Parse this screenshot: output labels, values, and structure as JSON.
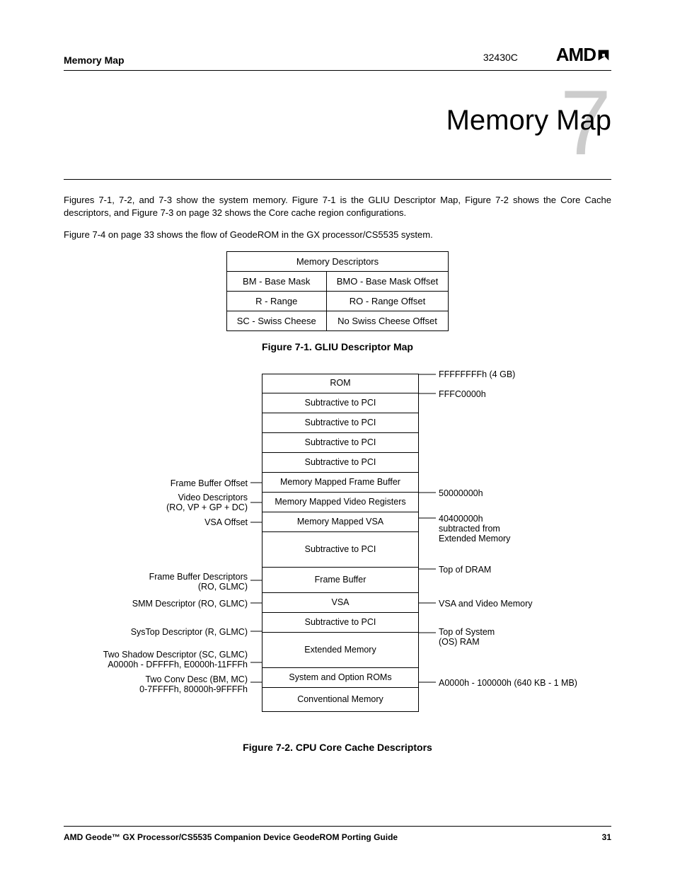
{
  "header": {
    "left": "Memory Map",
    "docnum": "32430C",
    "brand": "AMD"
  },
  "chapter": {
    "number": "7",
    "title": "Memory Map"
  },
  "paragraphs": {
    "p1": "Figures 7-1, 7-2, and 7-3 show the system memory. Figure 7-1 is the GLIU Descriptor Map, Figure 7-2 shows the Core Cache descriptors, and Figure 7-3 on page 32 shows the Core cache region configurations.",
    "p2": "Figure 7-4 on page 33 shows the flow of GeodeROM in the GX processor/CS5535 system."
  },
  "md_table": {
    "title": "Memory Descriptors",
    "rows": [
      [
        "BM - Base Mask",
        "BMO - Base Mask Offset"
      ],
      [
        "R - Range",
        "RO - Range Offset"
      ],
      [
        "SC - Swiss Cheese",
        "No Swiss Cheese Offset"
      ]
    ]
  },
  "fig1_caption": "Figure 7-1.  GLIU Descriptor Map",
  "fig2_caption": "Figure 7-2.  CPU Core Cache Descriptors",
  "diagram": {
    "boxes": [
      "ROM",
      "Subtractive to PCI",
      "Subtractive to PCI",
      "Subtractive to PCI",
      "Subtractive to PCI",
      "Memory Mapped Frame Buffer",
      "Memory Mapped Video Registers",
      "Memory Mapped VSA",
      "Subtractive to PCI",
      "Frame Buffer",
      "VSA",
      "Subtractive to PCI",
      "Extended Memory",
      "System and Option ROMs",
      "Conventional Memory"
    ],
    "left_labels": {
      "l1": "Frame Buffer Offset",
      "l2a": "Video Descriptors",
      "l2b": "(RO, VP + GP + DC)",
      "l3": "VSA Offset",
      "l4a": "Frame Buffer Descriptors",
      "l4b": "(RO, GLMC)",
      "l5": "SMM Descriptor (RO, GLMC)",
      "l6": "SysTop Descriptor (R, GLMC)",
      "l7a": "Two Shadow Descriptor (SC, GLMC)",
      "l7b": "A0000h - DFFFFh, E0000h-11FFFh",
      "l8a": "Two Conv Desc (BM, MC)",
      "l8b": "0-7FFFFh, 80000h-9FFFFh"
    },
    "right_labels": {
      "r1": "FFFFFFFFh (4 GB)",
      "r2": "FFFC0000h",
      "r3": "50000000h",
      "r4a": "40400000h",
      "r4b": "subtracted from",
      "r4c": "Extended Memory",
      "r5": "Top of DRAM",
      "r6": "VSA and Video Memory",
      "r7a": "Top of System",
      "r7b": "(OS) RAM",
      "r8": "A0000h - 100000h (640 KB - 1 MB)"
    }
  },
  "footer": {
    "left": "AMD Geode™ GX Processor/CS5535 Companion Device GeodeROM Porting Guide",
    "page": "31"
  }
}
